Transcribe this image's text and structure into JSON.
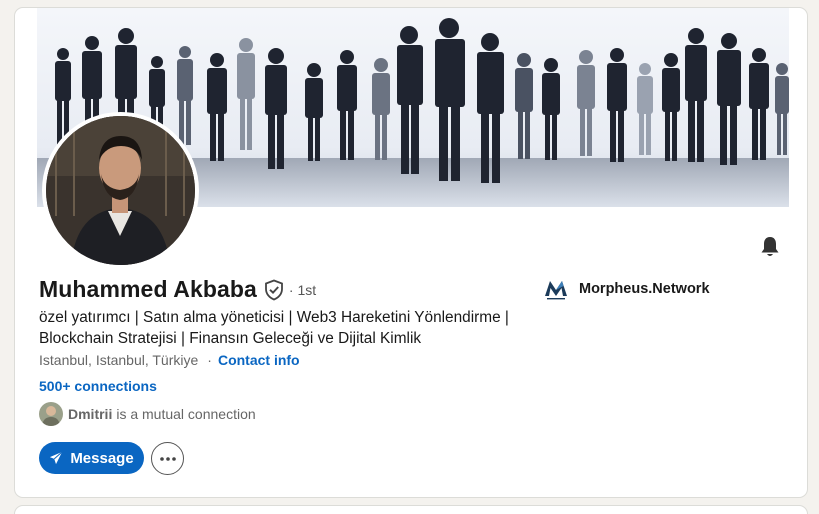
{
  "profile": {
    "name": "Muhammed Akbaba",
    "degree": "· 1st",
    "headline": "özel yatırımcı | Satın alma yöneticisi | Web3 Hareketini Yönlendirme | Blockchain Stratejisi | Finansın Geleceği ve Dijital Kimlik",
    "location": "Istanbul, Istanbul, Türkiye",
    "location_separator": "·",
    "contact_info_label": "Contact info",
    "connections_label": "500+ connections"
  },
  "mutual": {
    "name": "Dmitrii",
    "text": "is a mutual connection"
  },
  "actions": {
    "message_label": "Message"
  },
  "company": {
    "name": "Morpheus.Network"
  },
  "icons": {
    "verified": "shield-check-icon",
    "bell": "bell-icon",
    "send": "paper-plane-icon",
    "more": "ellipsis-icon"
  },
  "colors": {
    "accent": "#0a66c2",
    "text": "#191919",
    "secondary": "#666666",
    "background": "#f4f2ee"
  }
}
